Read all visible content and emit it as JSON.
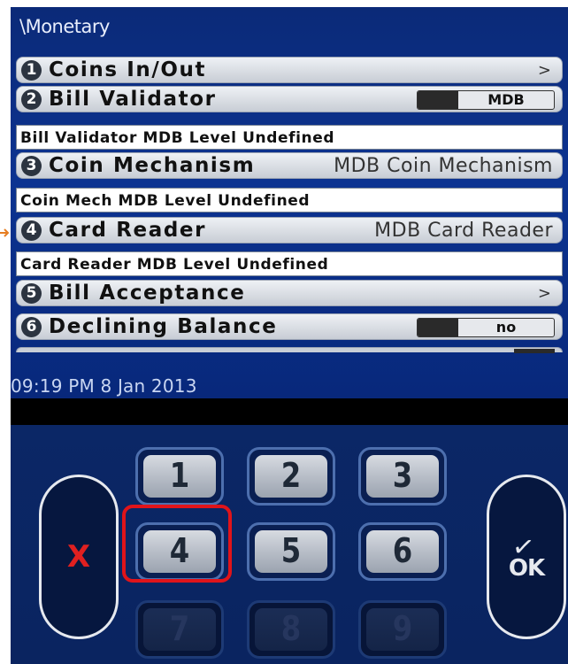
{
  "screen": {
    "title": "\\Monetary",
    "datetime": "09:19 PM 8 Jan 2013",
    "rows": [
      {
        "num": "1",
        "label": "Coins In/Out",
        "arrow": ">"
      },
      {
        "num": "2",
        "label": "Bill Validator",
        "toggle_value": "MDB"
      },
      {
        "info": "Bill Validator MDB Level Undefined"
      },
      {
        "num": "3",
        "label": "Coin Mechanism",
        "value": "MDB Coin Mechanism"
      },
      {
        "info": "Coin Mech MDB Level Undefined"
      },
      {
        "num": "4",
        "label": "Card Reader",
        "value": "MDB Card Reader"
      },
      {
        "info": "Card Reader MDB Level Undefined"
      },
      {
        "num": "5",
        "label": "Bill Acceptance",
        "arrow": ">"
      },
      {
        "num": "6",
        "label": "Declining Balance",
        "toggle_value": "no"
      }
    ]
  },
  "keypad": {
    "keys": [
      "1",
      "2",
      "3",
      "4",
      "5",
      "6",
      "7",
      "8",
      "9"
    ],
    "cancel_label": "X",
    "ok_check": "✓",
    "ok_label": "OK",
    "highlighted_key": "4"
  },
  "colors": {
    "highlight": "#e0141a",
    "cancel": "#e02020",
    "screen_bg": "#0c3391"
  }
}
